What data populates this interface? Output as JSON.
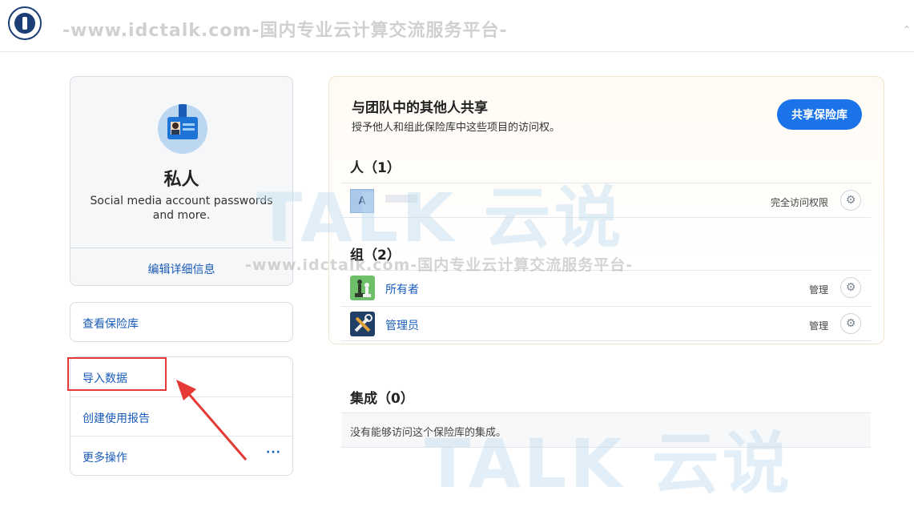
{
  "watermark": {
    "text": "-www.idctalk.com-国内专业云计算交流服务平台-",
    "logo": "TALK 云说"
  },
  "vault": {
    "name": "私人",
    "description": "Social media account passwords and more.",
    "edit_link": "编辑详细信息",
    "view_link": "查看保险库"
  },
  "actions": {
    "import": "导入数据",
    "report": "创建使用报告",
    "more": "更多操作",
    "more_icon": "···"
  },
  "share": {
    "title": "与团队中的其他人共享",
    "description": "授予他人和组此保险库中这些项目的访问权。",
    "button": "共享保险库"
  },
  "people": {
    "heading": "人（1）",
    "items": [
      {
        "avatar_letter": "A",
        "permission": "完全访问权限"
      }
    ]
  },
  "groups": {
    "heading": "组（2）",
    "items": [
      {
        "name": "所有者",
        "permission": "管理",
        "icon": "chess-pieces-icon"
      },
      {
        "name": "管理员",
        "permission": "管理",
        "icon": "tools-icon"
      }
    ]
  },
  "integrations": {
    "heading": "集成（0）",
    "empty_text": "没有能够访问这个保险库的集成。"
  },
  "colors": {
    "accent": "#1a73e8",
    "link": "#1a5cb8",
    "highlight": "#e53935"
  }
}
